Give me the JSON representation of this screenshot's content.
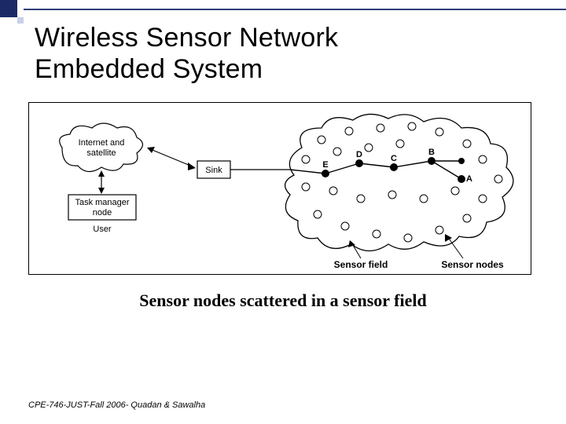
{
  "title_line1": "Wireless Sensor Network",
  "title_line2": "Embedded System",
  "caption": "Sensor nodes scattered in a sensor field",
  "footer": "CPE-746-JUST-Fall 2006- Quadan & Sawalha",
  "diagram": {
    "internet_label_l1": "Internet and",
    "internet_label_l2": "satellite",
    "task_label_l1": "Task manager",
    "task_label_l2": "node",
    "user_label": "User",
    "sink_label": "Sink",
    "nodes": {
      "A": "A",
      "B": "B",
      "C": "C",
      "D": "D",
      "E": "E"
    },
    "annot_field": "Sensor field",
    "annot_nodes": "Sensor nodes"
  }
}
